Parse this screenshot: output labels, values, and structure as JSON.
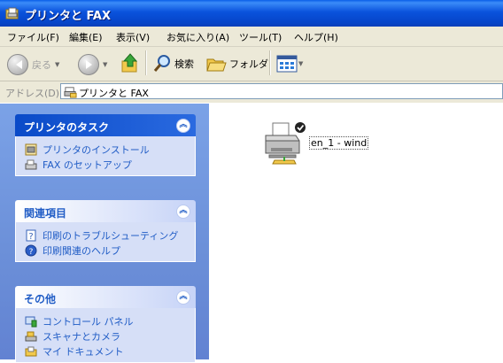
{
  "window": {
    "title": "プリンタと FAX"
  },
  "menu": [
    "ファイル(F)",
    "編集(E)",
    "表示(V)",
    "お気に入り(A)",
    "ツール(T)",
    "ヘルプ(H)"
  ],
  "toolbar": {
    "back": "戻る",
    "search": "検索",
    "folders": "フォルダ"
  },
  "address": {
    "label": "アドレス(D)",
    "value": "プリンタと FAX"
  },
  "panels": {
    "tasks": {
      "title": "プリンタのタスク",
      "items": [
        "プリンタのインストール",
        "FAX のセットアップ"
      ]
    },
    "related": {
      "title": "関連項目",
      "items": [
        "印刷のトラブルシューティング",
        "印刷関連のヘルプ"
      ]
    },
    "other": {
      "title": "その他",
      "items": [
        "コントロール パネル",
        "スキャナとカメラ",
        "マイ ドキュメント"
      ]
    }
  },
  "printers": [
    {
      "name": "en_1 - wind"
    }
  ],
  "colors": {
    "title_bar": "#0a52dc",
    "task_link": "#215dc6",
    "task_pane": "#7ba2e7",
    "panel_body": "#d6dff7"
  }
}
